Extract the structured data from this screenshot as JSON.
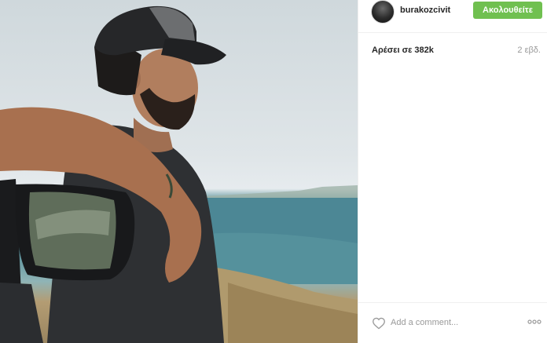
{
  "post": {
    "username": "burakozcivit",
    "follow_label": "Ακολουθείτε",
    "likes_text": "Αρέσει σε 382k",
    "time_ago": "2 εβδ.",
    "comment_placeholder": "Add a comment...",
    "photo_alt": ""
  },
  "colors": {
    "follow_bg": "#70c050",
    "text": "#262626",
    "muted": "#999999",
    "divider": "#efefef"
  },
  "icons": {
    "like": "heart-icon",
    "more": "more-options-icon"
  }
}
